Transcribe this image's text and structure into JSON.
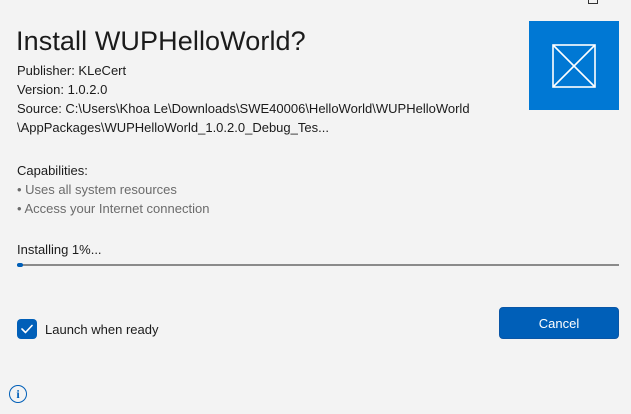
{
  "dialog": {
    "title": "Install WUPHelloWorld?",
    "publisher": "Publisher: KLeCert",
    "version": "Version: 1.0.2.0",
    "source_line1": "Source: C:\\Users\\Khoa Le\\Downloads\\SWE40006\\HelloWorld\\WUPHelloWorld",
    "source_line2": "\\AppPackages\\WUPHelloWorld_1.0.2.0_Debug_Tes..."
  },
  "capabilities": {
    "heading": "Capabilities:",
    "items": [
      "• Uses all system resources",
      "• Access your Internet connection"
    ]
  },
  "progress": {
    "label": "Installing 1%...",
    "percent": 1
  },
  "launch": {
    "label": "Launch when ready",
    "checked": true
  },
  "buttons": {
    "cancel": "Cancel"
  },
  "icons": {
    "app_tile": "placeholder-app-icon",
    "info": "info-icon",
    "checkbox_check": "checkmark-icon"
  },
  "colors": {
    "accent": "#005fb8",
    "tile": "#0078d4",
    "background": "#f3f3f3"
  }
}
